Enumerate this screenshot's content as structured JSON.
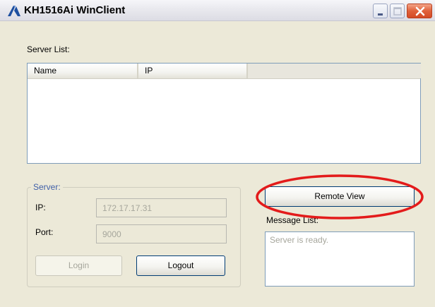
{
  "window": {
    "title": "KH1516Ai WinClient",
    "accent_color": "#d44a25"
  },
  "server_list": {
    "label": "Server List:",
    "columns": [
      "Name",
      "IP",
      ""
    ],
    "rows": []
  },
  "server": {
    "group_label": "Server:",
    "ip_label": "IP:",
    "ip_value": "172.17.17.31",
    "port_label": "Port:",
    "port_value": "9000",
    "login_label": "Login",
    "logout_label": "Logout"
  },
  "remote_view_label": "Remote View",
  "message_list": {
    "label": "Message List:",
    "messages": [
      "Server is ready."
    ]
  },
  "annotation": {
    "color": "#e31b1b"
  }
}
